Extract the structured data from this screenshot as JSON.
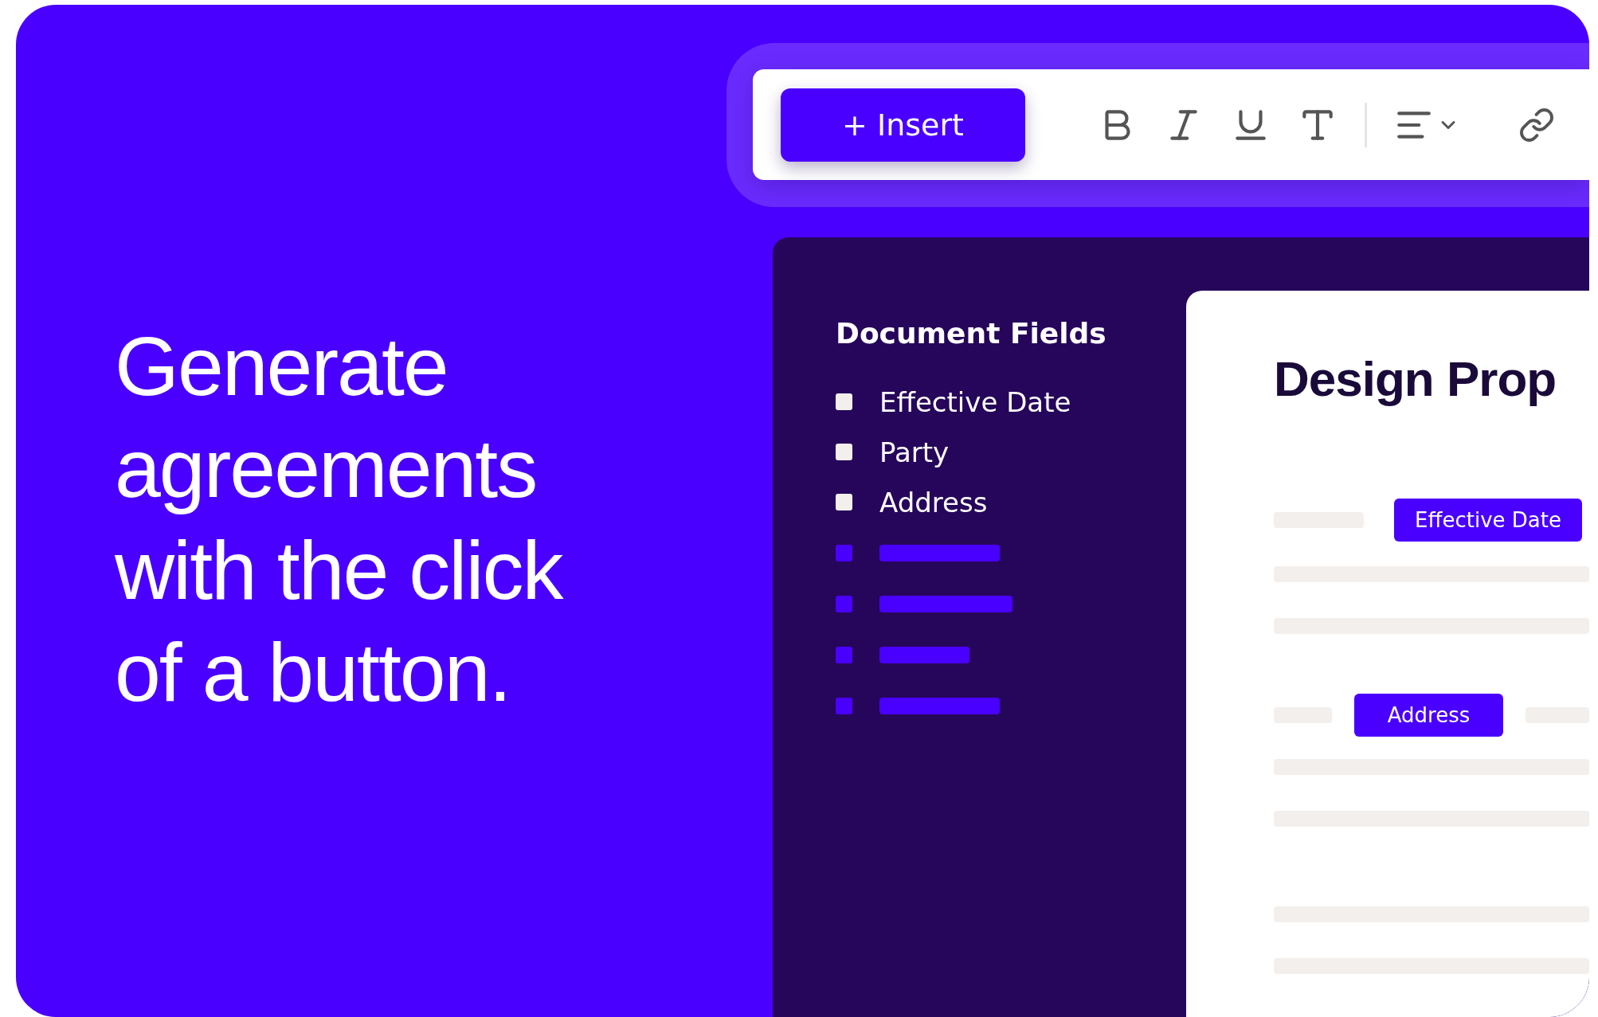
{
  "headline": "Generate agreements with the click of a button.",
  "toolbar": {
    "insert_button": "+ Insert"
  },
  "sidebar": {
    "title": "Document Fields",
    "fields": [
      "Effective Date",
      "Party",
      "Address"
    ]
  },
  "document": {
    "title": "Design Prop",
    "chips": [
      "Effective Date",
      "Address"
    ]
  }
}
